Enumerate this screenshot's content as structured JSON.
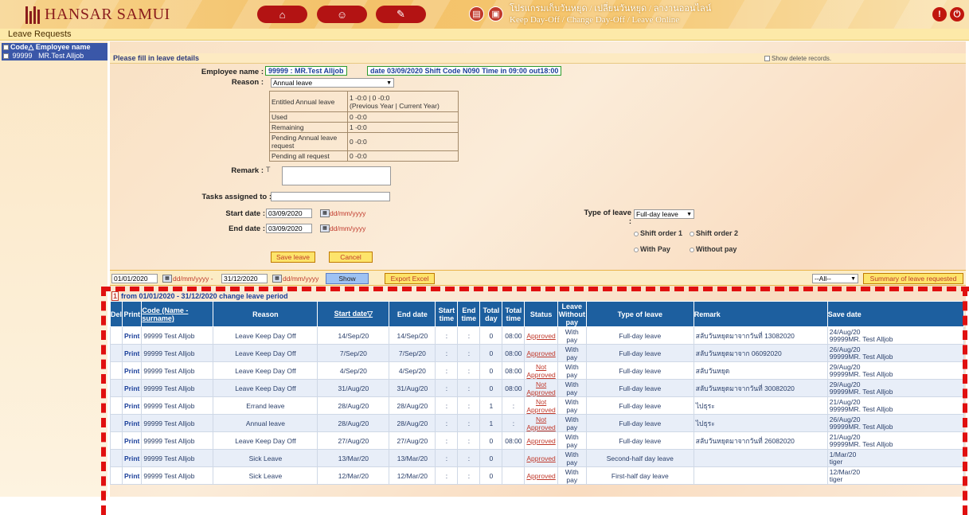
{
  "header": {
    "brand": "HANSAR SAMUI",
    "title_th": "โปรแกรมเก็บวันหยุด / เปลี่ยนวันหยุด / ลางานออนไลน์",
    "title_en": "Keep Day-Off / Change Day-Off / Leave Online",
    "icons": [
      "home-icon",
      "user-icon",
      "edit-icon",
      "book-icon",
      "document-icon",
      "alert-icon",
      "logout-icon"
    ]
  },
  "page_title": "Leave Requests",
  "left_panel": {
    "header": "Code△ Employee name",
    "rows": [
      {
        "code": "99999",
        "name": "MR.Test Alljob"
      }
    ]
  },
  "form": {
    "section_title": "Please fill in leave details",
    "show_deleted": "Show delete records.",
    "employee_label": "Employee name :",
    "employee_value": "99999 : MR.Test Alljob",
    "shift_info": "date 03/09/2020 Shift Code N090 Time in 09:00 out18:00",
    "reason_label": "Reason :",
    "reason_value": "Annual leave",
    "entitlement": [
      {
        "label": "Entitled Annual leave",
        "value": "1 -0:0 | 0 -0:0\n(Previous Year | Current Year)"
      },
      {
        "label": "Used",
        "value": "0 -0:0"
      },
      {
        "label": "Remaining",
        "value": "1 -0:0"
      },
      {
        "label": "Pending Annual leave request",
        "value": "0 -0:0"
      },
      {
        "label": "Pending all request",
        "value": "0 -0:0"
      }
    ],
    "remark_label": "Remark :",
    "tasks_label": "Tasks assigned to :",
    "start_label": "Start date :",
    "start_value": "03/09/2020",
    "end_label": "End date :",
    "end_value": "03/09/2020",
    "date_hint": "dd/mm/yyyy",
    "type_label": "Type of leave :",
    "type_value": "Full-day leave",
    "shift1": "Shift order 1",
    "shift2": "Shift order 2",
    "with_pay": "With Pay",
    "without_pay": "Without pay",
    "save_btn": "Save leave",
    "cancel_btn": "Cancel"
  },
  "filter": {
    "from": "01/01/2020",
    "to": "31/12/2020",
    "hint": "dd/mm/yyyy",
    "dash": "-",
    "show_btn": "Show",
    "export_btn": "Export Excel",
    "all_option": "--All--",
    "summary_btn": "Summary of leave requested"
  },
  "period": {
    "count": "1",
    "text": "from 01/01/2020 - 31/12/2020 change leave period"
  },
  "table": {
    "headers": [
      "Del",
      "Print",
      "Code (Name - surname)",
      "Reason",
      "Start date▽",
      "End date",
      "Start time",
      "End time",
      "Total day",
      "Total time",
      "Status",
      "Leave Without pay",
      "Type of leave",
      "Remark",
      "Save date"
    ],
    "rows": [
      {
        "print": "Print",
        "code": "99999 Test Alljob",
        "reason": "Leave Keep Day Off",
        "start": "14/Sep/20",
        "end": "14/Sep/20",
        "st": ":",
        "et": ":",
        "day": "0",
        "time": "08:00",
        "status": "Approved",
        "pay": "With pay",
        "type": "Full-day leave",
        "remark": "สลับวันหยุดมาจากวันที่ 13082020",
        "save1": "24/Aug/20",
        "save2": "99999MR. Test Alljob"
      },
      {
        "print": "Print",
        "code": "99999 Test Alljob",
        "reason": "Leave Keep Day Off",
        "start": "7/Sep/20",
        "end": "7/Sep/20",
        "st": ":",
        "et": ":",
        "day": "0",
        "time": "08:00",
        "status": "Approved",
        "pay": "With pay",
        "type": "Full-day leave",
        "remark": "สลับวันหยุดมาจาก 06092020",
        "save1": "26/Aug/20",
        "save2": "99999MR. Test Alljob"
      },
      {
        "print": "Print",
        "code": "99999 Test Alljob",
        "reason": "Leave Keep Day Off",
        "start": "4/Sep/20",
        "end": "4/Sep/20",
        "st": ":",
        "et": ":",
        "day": "0",
        "time": "08:00",
        "status": "Not Approved",
        "pay": "With pay",
        "type": "Full-day leave",
        "remark": "สลับวันหยุด",
        "save1": "29/Aug/20",
        "save2": "99999MR. Test Alljob"
      },
      {
        "print": "Print",
        "code": "99999 Test Alljob",
        "reason": "Leave Keep Day Off",
        "start": "31/Aug/20",
        "end": "31/Aug/20",
        "st": ":",
        "et": ":",
        "day": "0",
        "time": "08:00",
        "status": "Not Approved",
        "pay": "With pay",
        "type": "Full-day leave",
        "remark": "สลับวันหยุดมาจากวันที่ 30082020",
        "save1": "29/Aug/20",
        "save2": "99999MR. Test Alljob"
      },
      {
        "print": "Print",
        "code": "99999 Test Alljob",
        "reason": "Errand leave",
        "start": "28/Aug/20",
        "end": "28/Aug/20",
        "st": ":",
        "et": ":",
        "day": "1",
        "time": ":",
        "status": "Not Approved",
        "pay": "With pay",
        "type": "Full-day leave",
        "remark": "ไปธุระ",
        "save1": "21/Aug/20",
        "save2": "99999MR. Test Alljob"
      },
      {
        "print": "Print",
        "code": "99999 Test Alljob",
        "reason": "Annual leave",
        "start": "28/Aug/20",
        "end": "28/Aug/20",
        "st": ":",
        "et": ":",
        "day": "1",
        "time": ":",
        "status": "Not Approved",
        "pay": "With pay",
        "type": "Full-day leave",
        "remark": "ไปธุระ",
        "save1": "26/Aug/20",
        "save2": "99999MR. Test Alljob"
      },
      {
        "print": "Print",
        "code": "99999 Test Alljob",
        "reason": "Leave Keep Day Off",
        "start": "27/Aug/20",
        "end": "27/Aug/20",
        "st": ":",
        "et": ":",
        "day": "0",
        "time": "08:00",
        "status": "Approved",
        "pay": "With pay",
        "type": "Full-day leave",
        "remark": "สลับวันหยุดมาจากวันที่ 26082020",
        "save1": "21/Aug/20",
        "save2": "99999MR. Test Alljob"
      },
      {
        "print": "Print",
        "code": "99999 Test Alljob",
        "reason": "Sick Leave",
        "start": "13/Mar/20",
        "end": "13/Mar/20",
        "st": ":",
        "et": ":",
        "day": "0",
        "time": "",
        "status": "Approved",
        "pay": "With pay",
        "type": "Second-half day leave",
        "remark": "",
        "save1": "1/Mar/20",
        "save2": "tiger"
      },
      {
        "print": "Print",
        "code": "99999 Test Alljob",
        "reason": "Sick Leave",
        "start": "12/Mar/20",
        "end": "12/Mar/20",
        "st": ":",
        "et": ":",
        "day": "0",
        "time": "",
        "status": "Approved",
        "pay": "With pay",
        "type": "First-half day leave",
        "remark": "",
        "save1": "12/Mar/20",
        "save2": "tiger"
      }
    ]
  }
}
